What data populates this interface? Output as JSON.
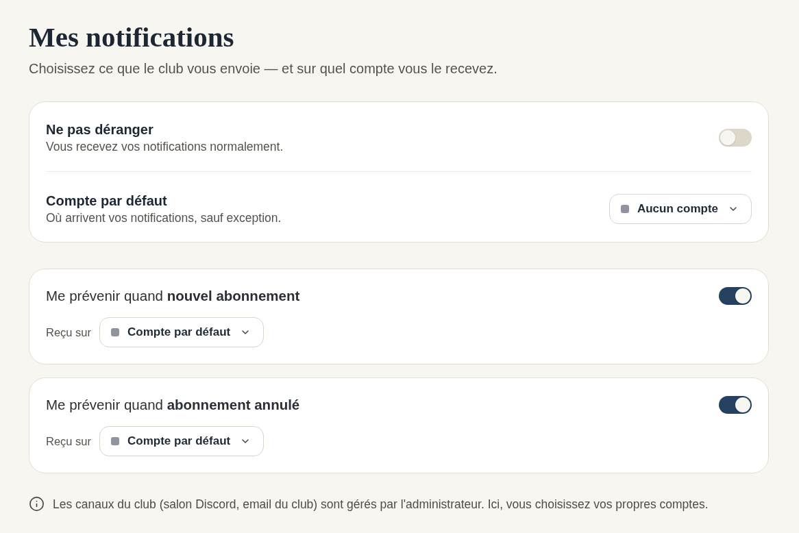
{
  "page": {
    "title": "Mes notifications",
    "subtitle": "Choisissez ce que le club vous envoie — et sur quel compte vous le recevez."
  },
  "general_settings": [
    {
      "kind": "toggle",
      "label": "Ne pas déranger",
      "description": "Vous recevez vos notifications normalement.",
      "on": false
    },
    {
      "kind": "select",
      "label": "Compte par défaut",
      "description": "Où arrivent vos notifications, sauf exception.",
      "value": "Aucun compte"
    }
  ],
  "notifications": [
    {
      "label": "Me prévenir quand **nouvel abonnement**",
      "on": true,
      "received_label": "Reçu sur",
      "account": "Compte par défaut"
    },
    {
      "label": "Me prévenir quand **abonnement annulé**",
      "on": true,
      "received_label": "Reçu sur",
      "account": "Compte par défaut"
    }
  ],
  "footer_note": "Les canaux du club (salon Discord, email du club) sont gérés par l'administrateur. Ici, vous choisissez vos propres comptes."
}
